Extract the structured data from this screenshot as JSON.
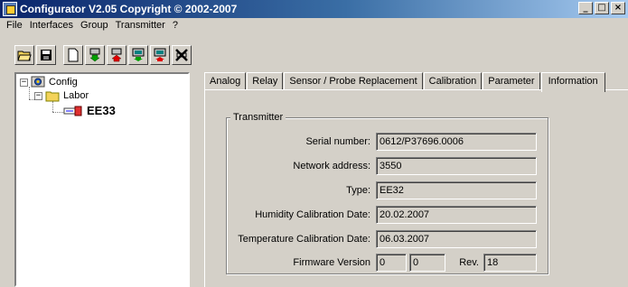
{
  "window": {
    "title": "Configurator  V2.05 Copyright © 2002-2007"
  },
  "caption_buttons": {
    "minimize": "_",
    "maximize": "□",
    "close": "×"
  },
  "menu": [
    "File",
    "Interfaces",
    "Group",
    "Transmitter",
    "?"
  ],
  "toolbar": {
    "buttons": [
      "open-folder-icon",
      "save-disk-icon",
      "new-document-icon",
      "download-green-icon",
      "upload-red-icon",
      "monitor-green-icon",
      "monitor-red-icon",
      "delete-cross-icon"
    ]
  },
  "tree": {
    "root": {
      "label": "Config",
      "expander": "−"
    },
    "group": {
      "label": "Labor",
      "expander": "−"
    },
    "device": {
      "label": "EE33"
    }
  },
  "tabs": [
    "Analog",
    "Relay",
    "Sensor / Probe Replacement",
    "Calibration",
    "Parameter",
    "Information"
  ],
  "active_tab": "Information",
  "transmitter": {
    "group_label": "Transmitter",
    "serial_label": "Serial number:",
    "serial_value": "0612/P37696.0006",
    "network_label": "Network address:",
    "network_value": "3550",
    "type_label": "Type:",
    "type_value": "EE32",
    "humidity_label": "Humidity Calibration Date:",
    "humidity_value": "20.02.2007",
    "temperature_label": "Temperature Calibration Date:",
    "temperature_value": "06.03.2007",
    "firmware_label": "Firmware Version",
    "firmware_major": "0",
    "firmware_minor": "0",
    "rev_label": "Rev.",
    "rev_value": "18"
  }
}
